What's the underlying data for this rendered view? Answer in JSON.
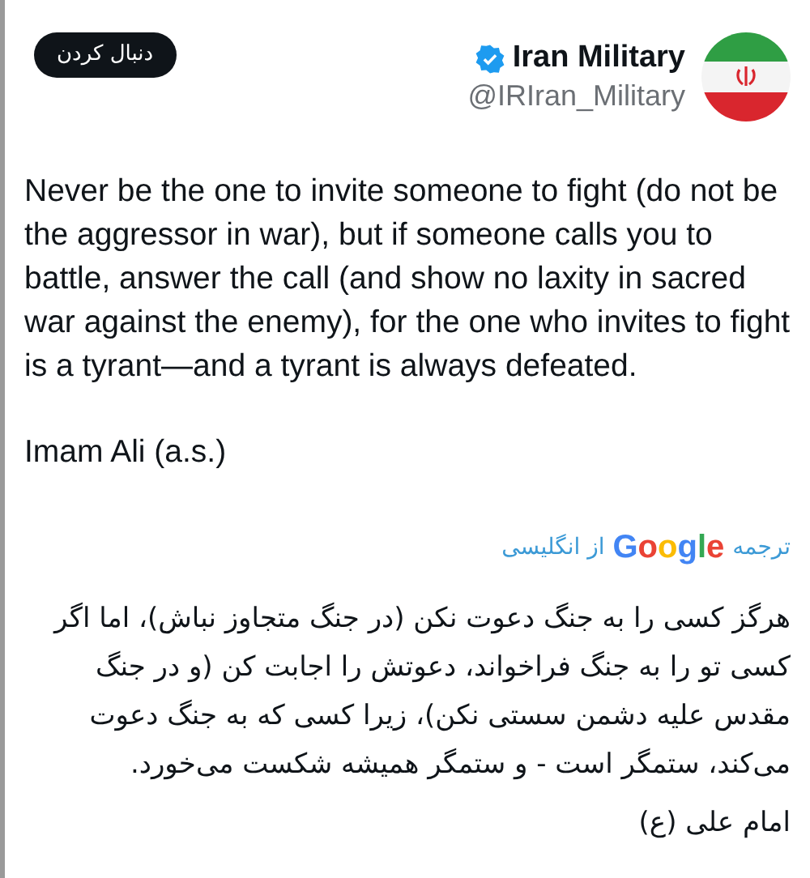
{
  "follow_button": "دنبال کردن",
  "author": {
    "name": "Iran Military",
    "verified": true,
    "handle": "@IRIran_Military"
  },
  "tweet_text": "Never be the one to invite someone to fight (do not be the aggressor in war), but if someone calls you to battle, answer the call (and show no laxity in sacred war against the enemy), for the one who invites to fight is a tyrant—and a tyrant is always defeated.",
  "attribution": "Imam Ali (a.s.)",
  "translate_label": {
    "prefix": "ترجمه",
    "brand": "Google",
    "suffix": "از انگلیسی"
  },
  "translation_text": "هرگز کسی را به جنگ دعوت نکن (در جنگ متجاوز نباش)، اما اگر کسی تو را به جنگ فراخواند، دعوتش را اجابت کن (و در جنگ مقدس علیه دشمن سستی نکن)، زیرا کسی که به جنگ دعوت می‌کند، ستمگر است - و ستمگر همیشه شکست می‌خورد.",
  "translation_attribution": "امام علی (ع)"
}
